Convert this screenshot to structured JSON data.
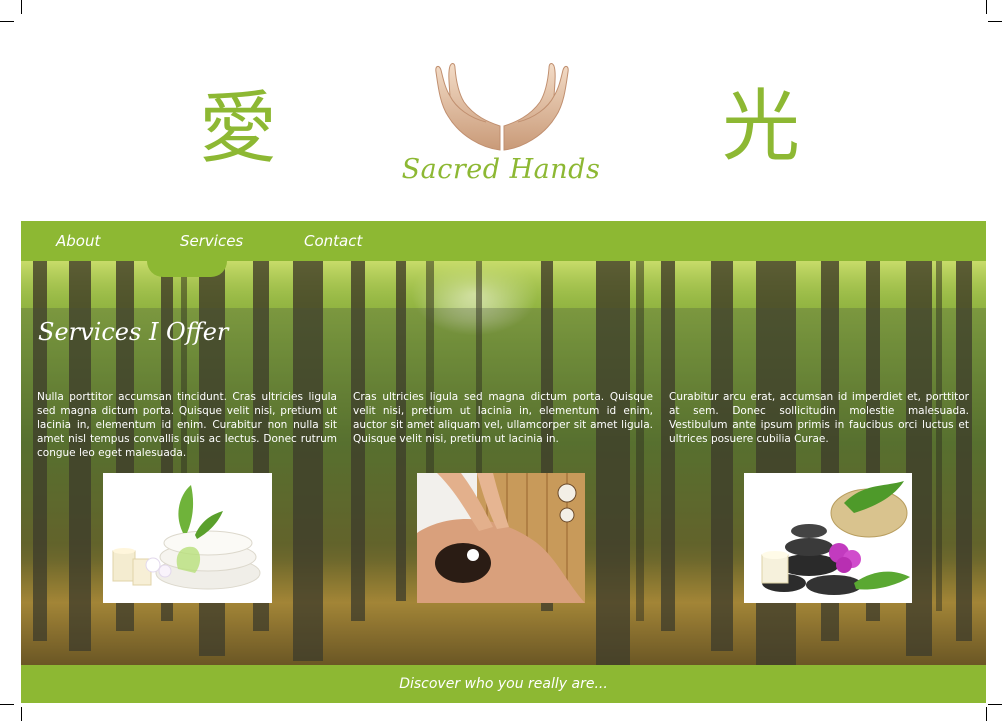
{
  "header": {
    "kanji_left": "愛",
    "kanji_right": "光",
    "logo_text": "Sacred Hands",
    "logo_icon": "open-hands-icon"
  },
  "nav": {
    "items": [
      {
        "label": "About"
      },
      {
        "label": "Services",
        "active": true
      },
      {
        "label": "Contact"
      }
    ]
  },
  "main": {
    "title": "Services I Offer",
    "columns": [
      {
        "text": "Nulla porttitor accumsan tincidunt. Cras ultricies ligula sed magna dictum porta. Quisque velit nisi, pretium ut lacinia in, elementum id enim. Curabitur non nulla sit amet nisl tempus convallis quis ac lectus. Donec rutrum congue leo eget malesuada.",
        "image": "spa-towels-candles-orchid"
      },
      {
        "text": "Cras ultricies ligula sed magna dictum porta. Quisque velit nisi, pretium ut lacinia in, elementum id enim, auctor sit amet aliquam vel, ullamcorper sit amet ligula. Quisque velit nisi, pretium ut lacinia in.",
        "image": "back-massage"
      },
      {
        "text": "Curabitur arcu erat, accumsan id imperdiet et, porttitor at sem. Donec sollicitudin molestie malesuada. Vestibulum ante ipsum primis in faucibus orci luctus et ultrices posuere cubilia Curae.",
        "image": "hot-stones-orchid"
      }
    ]
  },
  "footer": {
    "tagline": "Discover who you really are..."
  },
  "colors": {
    "accent": "#8db833",
    "text_on_accent": "#ffffff"
  }
}
